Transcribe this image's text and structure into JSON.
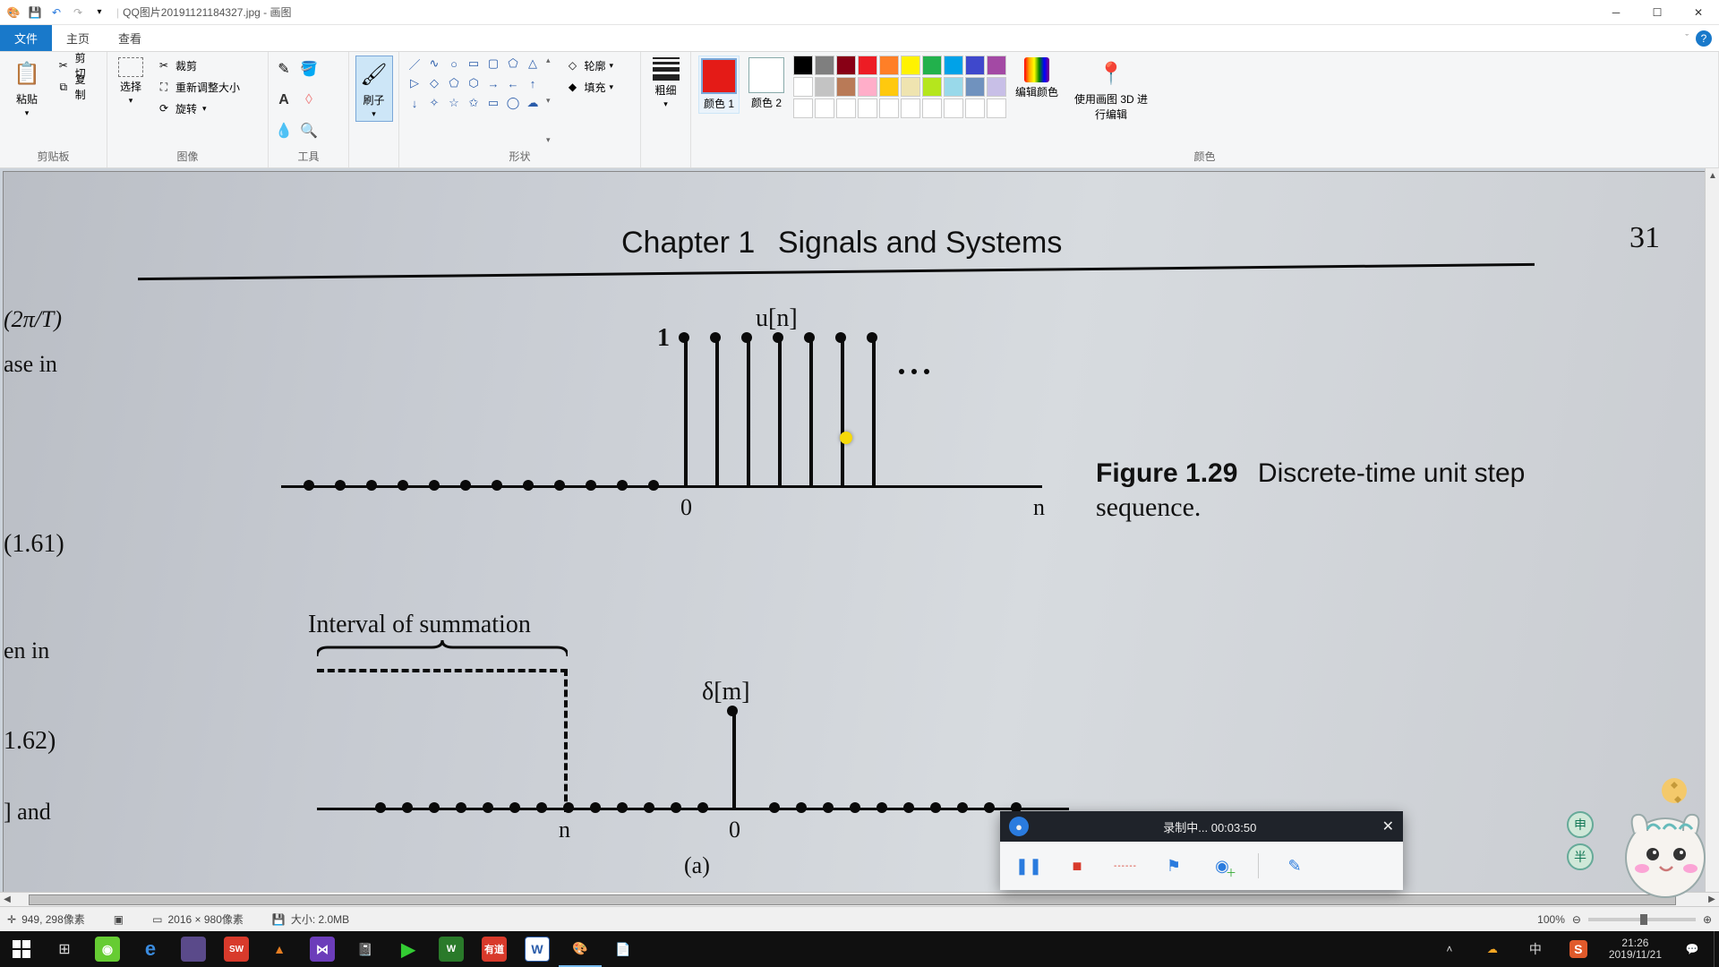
{
  "titlebar": {
    "filename": "QQ图片20191121184327.jpg - 画图"
  },
  "tabs": {
    "file": "文件",
    "home": "主页",
    "view": "查看"
  },
  "ribbon": {
    "clipboard": {
      "paste": "粘贴",
      "cut": "剪切",
      "copy": "复制",
      "label": "剪贴板"
    },
    "image": {
      "select": "选择",
      "crop": "裁剪",
      "resize": "重新调整大小",
      "rotate": "旋转",
      "label": "图像"
    },
    "tools": {
      "label": "工具"
    },
    "brushes": {
      "brush": "刷子",
      "label": ""
    },
    "shapes": {
      "outline": "轮廓",
      "fill": "填充",
      "label": "形状"
    },
    "size": {
      "label": "粗细"
    },
    "colors": {
      "c1a": "颜色 1",
      "c2a": "颜色 2",
      "edit": "编辑颜色",
      "p3d": "使用画图 3D 进行编辑",
      "label": "颜色"
    }
  },
  "palette_row1": [
    "#000000",
    "#7f7f7f",
    "#880015",
    "#ed1c24",
    "#ff7f27",
    "#fff200",
    "#22b14c",
    "#00a2e8",
    "#3f48cc",
    "#a349a4"
  ],
  "palette_row2": [
    "#ffffff",
    "#c3c3c3",
    "#b97a57",
    "#ffaec9",
    "#ffc90e",
    "#efe4b0",
    "#b5e61d",
    "#99d9ea",
    "#7092be",
    "#c8bfe7"
  ],
  "palette_row3": [
    "#ffffff",
    "#ffffff",
    "#ffffff",
    "#ffffff",
    "#ffffff",
    "#ffffff",
    "#ffffff",
    "#ffffff",
    "#ffffff",
    "#ffffff"
  ],
  "canvas": {
    "chapter": "Chapter 1",
    "chtitle": "Signals and Systems",
    "pagenum": "31",
    "left1": "(2π/T)",
    "left2": "ase in",
    "left3": "(1.61)",
    "left4": "en in",
    "left5": "1.62)",
    "left6": "] and",
    "u_label": "u[n]",
    "one": "1",
    "zero": "0",
    "n": "n",
    "fig_a": "Figure 1.29",
    "fig_b": "Discrete-time unit step",
    "fig_c": "sequence.",
    "interval": "Interval of summation",
    "delta": "δ[m]",
    "n2": "n",
    "zero2": "0",
    "a": "(a)"
  },
  "recorder": {
    "status": "录制中... 00:03:50"
  },
  "status": {
    "pos": "949, 298像素",
    "dim": "2016 × 980像素",
    "size": "大小: 2.0MB",
    "zoom": "100%"
  },
  "mascot": {
    "badge1": "申",
    "badge2": "半"
  },
  "clock": {
    "time": "21:26",
    "date": "2019/11/21"
  }
}
